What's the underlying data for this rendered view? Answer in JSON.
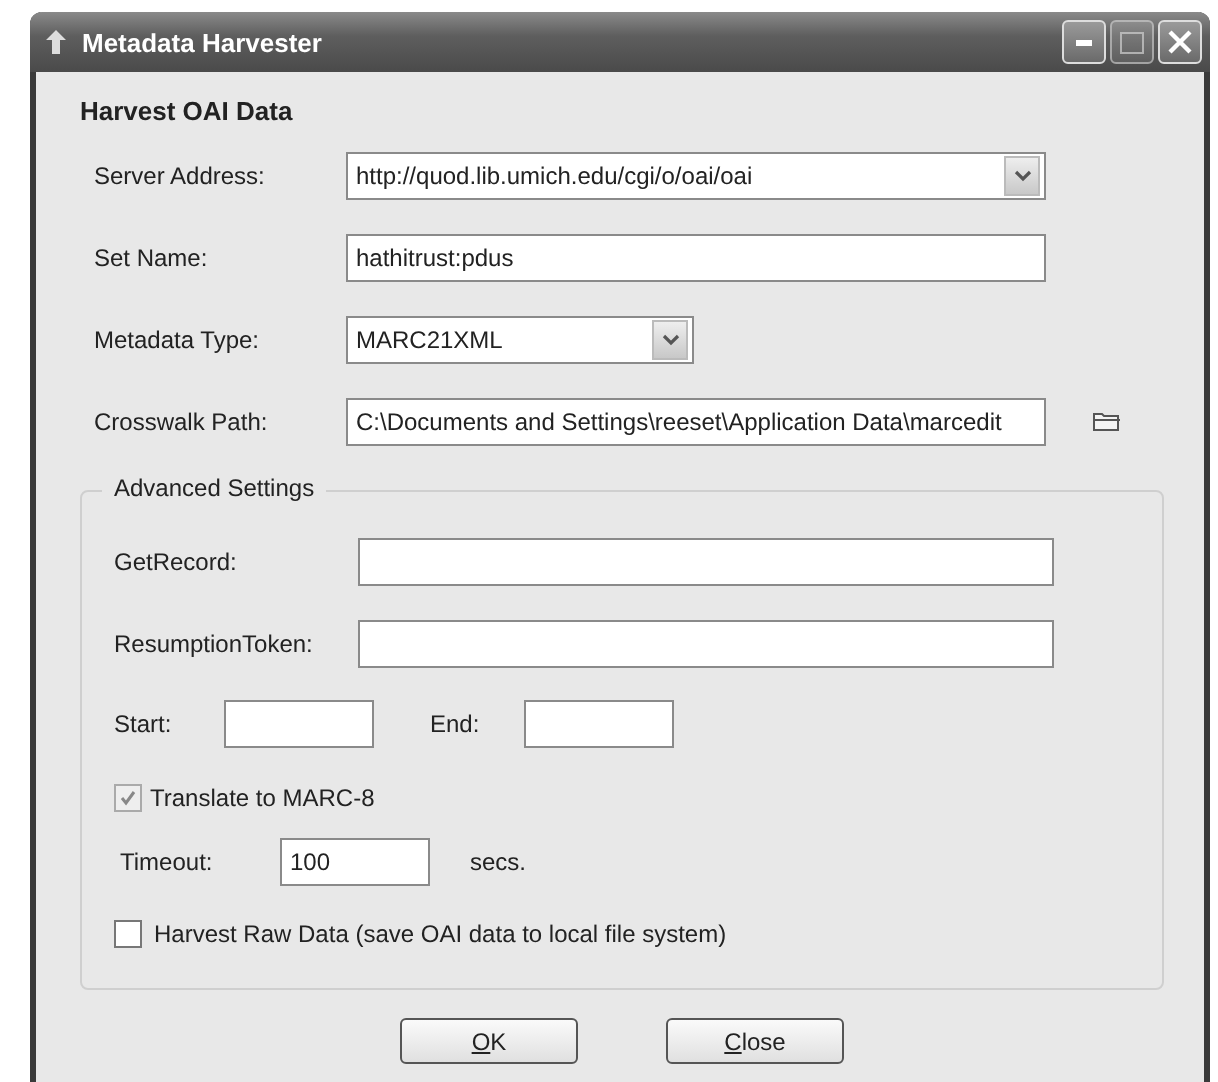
{
  "window": {
    "title": "Metadata Harvester"
  },
  "heading": "Harvest OAI Data",
  "fields": [
    {
      "label": "Server Address:",
      "value": "http://quod.lib.umich.edu/cgi/o/oai/oai",
      "kind": "dropdown"
    },
    {
      "label": "Set Name:",
      "value": "hathitrust:pdus",
      "kind": "text"
    },
    {
      "label": "Metadata Type:",
      "value": "MARC21XML",
      "kind": "dropdown"
    },
    {
      "label": "Crosswalk Path:",
      "value": "C:\\Documents and Settings\\reeset\\Application Data\\marcedit",
      "kind": "browse"
    }
  ],
  "advanced": {
    "legend": "Advanced Settings",
    "get_record": {
      "label": "GetRecord:"
    },
    "resumption_token": {
      "label": "ResumptionToken:"
    },
    "start": {
      "label": "Start:"
    },
    "end": {
      "label": "End:"
    },
    "translate": {
      "label": "Translate to MARC-8",
      "checked": true
    },
    "timeout": {
      "label": "Timeout:",
      "value": "100",
      "unit": "secs."
    },
    "harvest_raw": {
      "label": "Harvest Raw Data (save OAI data to local file system)",
      "checked": false
    }
  },
  "buttons": [
    {
      "label": "OK"
    },
    {
      "label": "Close"
    }
  ]
}
